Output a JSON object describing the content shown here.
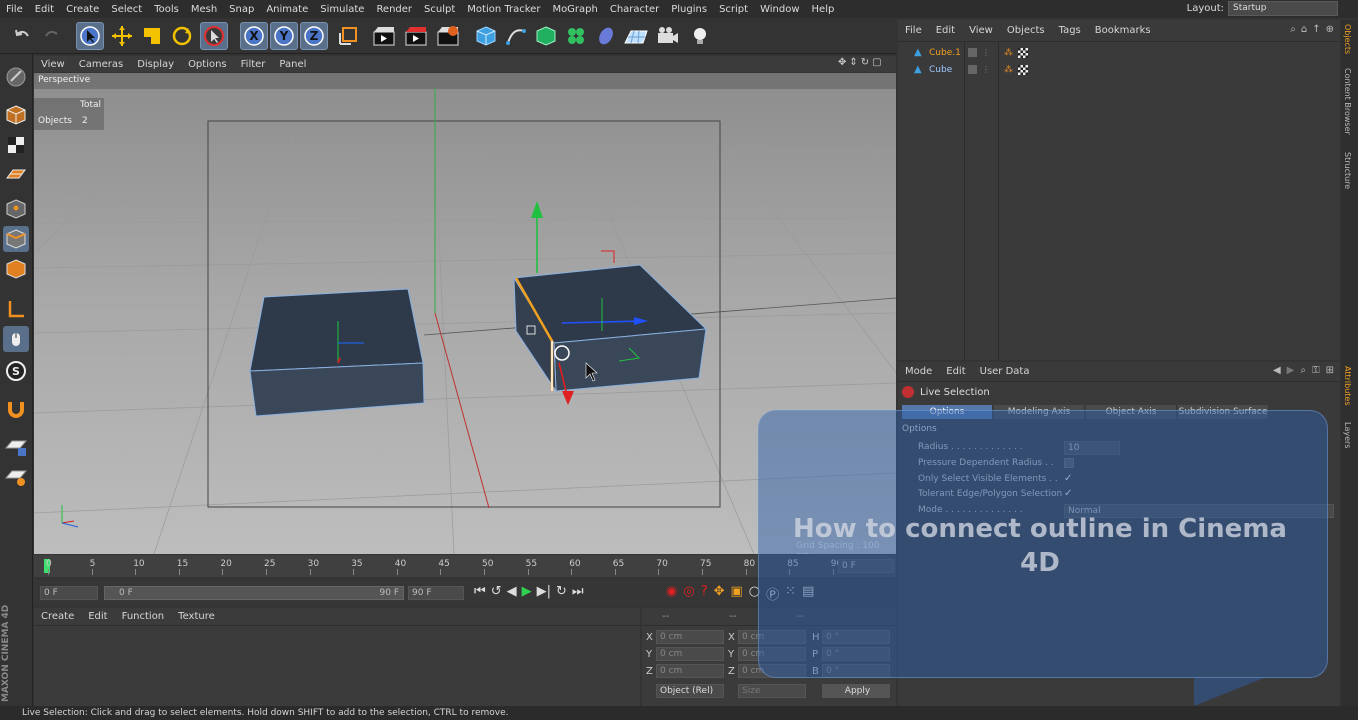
{
  "menu": [
    "File",
    "Edit",
    "Create",
    "Select",
    "Tools",
    "Mesh",
    "Snap",
    "Animate",
    "Simulate",
    "Render",
    "Sculpt",
    "Motion Tracker",
    "MoGraph",
    "Character",
    "Plugins",
    "Script",
    "Window",
    "Help"
  ],
  "layout": {
    "label": "Layout:",
    "value": "Startup"
  },
  "viewport": {
    "menu": [
      "View",
      "Cameras",
      "Display",
      "Options",
      "Filter",
      "Panel"
    ],
    "camera_label": "Perspective",
    "stats_total": "Total",
    "stats_objects_label": "Objects",
    "stats_objects_value": "2",
    "grid_spacing": "Grid Spacing : 100 cm"
  },
  "timeline": {
    "ticks": [
      "0",
      "5",
      "10",
      "15",
      "20",
      "25",
      "30",
      "35",
      "40",
      "45",
      "50",
      "55",
      "60",
      "65",
      "70",
      "75",
      "80",
      "85",
      "90"
    ],
    "current_frame": "0 F"
  },
  "playbar": {
    "start": "0 F",
    "range_start": "0 F",
    "range_end": "90 F",
    "end": "90 F"
  },
  "material_menu": [
    "Create",
    "Edit",
    "Function",
    "Texture"
  ],
  "coords": {
    "header": [
      "--",
      "--",
      "--"
    ],
    "rows": [
      {
        "axis": "X",
        "pos": "0 cm",
        "axis2": "X",
        "size": "0 cm",
        "rot_label": "H",
        "rot": "0 °"
      },
      {
        "axis": "Y",
        "pos": "0 cm",
        "axis2": "Y",
        "size": "0 cm",
        "rot_label": "P",
        "rot": "0 °"
      },
      {
        "axis": "Z",
        "pos": "0 cm",
        "axis2": "Z",
        "size": "0 cm",
        "rot_label": "B",
        "rot": "0 °"
      }
    ],
    "mode_select": "Object (Rel)",
    "size_select": "Size",
    "apply": "Apply"
  },
  "objects_panel": {
    "menu": [
      "File",
      "Edit",
      "View",
      "Objects",
      "Tags",
      "Bookmarks"
    ],
    "items": [
      {
        "name": "Cube.1",
        "selected": true
      },
      {
        "name": "Cube",
        "selected": false
      }
    ]
  },
  "attributes": {
    "menu": [
      "Mode",
      "Edit",
      "User Data"
    ],
    "tool_title": "Live Selection",
    "tabs": [
      "Options",
      "Modeling Axis",
      "Object Axis",
      "Subdivision Surface"
    ],
    "section": "Options",
    "radius_label": "Radius . . . . . . . . . . . . .",
    "radius_value": "10",
    "pressure": "Pressure Dependent Radius . .",
    "visible_only": "Only Select Visible Elements . .",
    "tolerant": "Tolerant Edge/Polygon Selection",
    "mode_label": "Mode . . . . . . . . . . . . . .",
    "mode_value": "Normal"
  },
  "side_tabs": [
    "Objects",
    "Content Browser",
    "Structure",
    "Attributes",
    "Layers"
  ],
  "brand": "MAXON CINEMA 4D",
  "overlay_title": "How to connect outline in Cinema 4D",
  "status": "Live Selection: Click and drag to select elements. Hold down SHIFT to add to the selection, CTRL to remove.",
  "colors": {
    "accent": "#5577aa",
    "selection_orange": "#f0a020",
    "x_axis": "#e02020",
    "y_axis": "#20c040",
    "z_axis": "#2060ff"
  }
}
